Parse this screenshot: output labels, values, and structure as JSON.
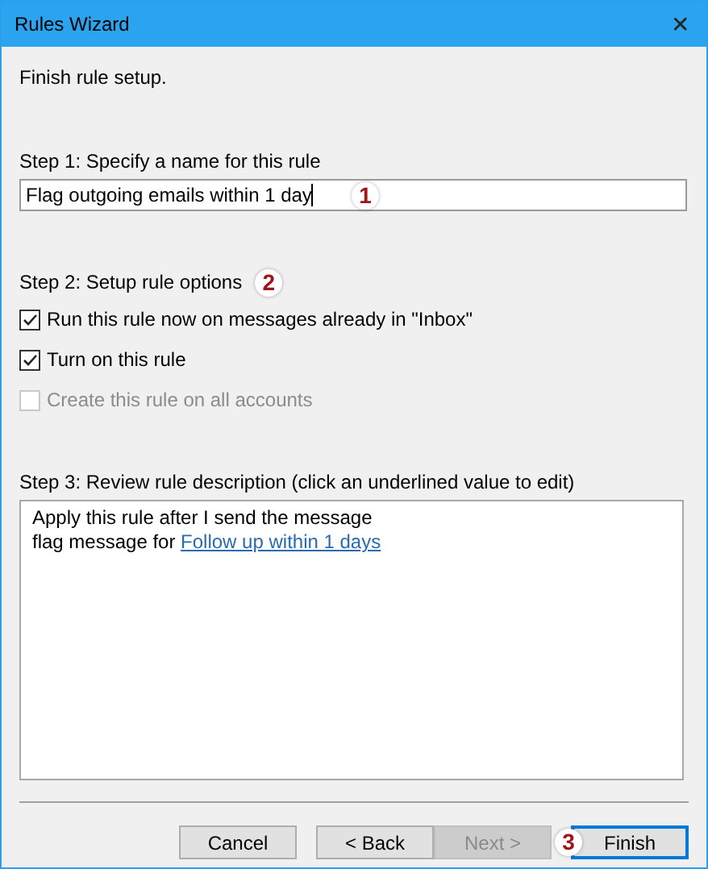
{
  "window": {
    "title": "Rules Wizard",
    "close": "✕"
  },
  "heading": "Finish rule setup.",
  "step1": {
    "label": "Step 1: Specify a name for this rule",
    "value": "Flag outgoing emails within 1 day",
    "badge": "1"
  },
  "step2": {
    "label": "Step 2: Setup rule options",
    "badge": "2",
    "options": [
      {
        "label": "Run this rule now on messages already in \"Inbox\"",
        "checked": true,
        "disabled": false
      },
      {
        "label": "Turn on this rule",
        "checked": true,
        "disabled": false
      },
      {
        "label": "Create this rule on all accounts",
        "checked": false,
        "disabled": true
      }
    ]
  },
  "step3": {
    "label": "Step 3: Review rule description (click an underlined value to edit)",
    "lines": [
      {
        "text": "Apply this rule after I send the message"
      },
      {
        "text": "flag message for ",
        "link": "Follow up within 1 days"
      }
    ]
  },
  "buttons": [
    {
      "label": "Cancel",
      "disabled": false,
      "default": false
    },
    {
      "label": "< Back",
      "disabled": false,
      "default": false
    },
    {
      "label": "Next >",
      "disabled": true,
      "default": false
    },
    {
      "label": "Finish",
      "disabled": false,
      "default": true,
      "badge": "3"
    }
  ]
}
